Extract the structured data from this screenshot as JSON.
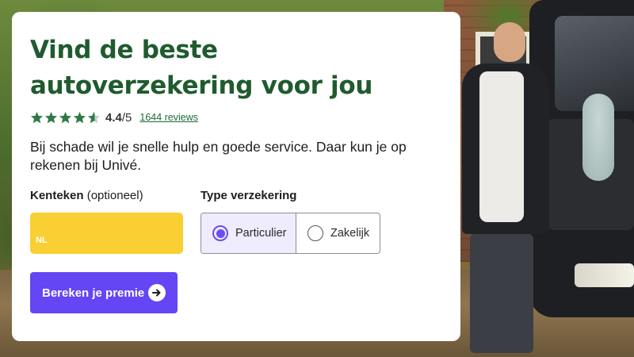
{
  "hero": {
    "title_line1": "Vind de beste",
    "title_line2": "autoverzekering voor jou",
    "rating": {
      "stars": 4.4,
      "max": 5,
      "score_text": "4.4",
      "max_text": "/5",
      "reviews_link": "1644 reviews"
    },
    "description": "Bij schade wil je snelle hulp en goede service. Daar kun je op rekenen bij Univé.",
    "kenteken": {
      "label": "Kenteken",
      "label_suffix": " (optioneel)",
      "country_code": "NL",
      "value": ""
    },
    "type": {
      "label": "Type verzekering",
      "options": [
        {
          "label": "Particulier",
          "selected": true
        },
        {
          "label": "Zakelijk",
          "selected": false
        }
      ]
    },
    "cta": {
      "label": "Bereken je premie"
    }
  },
  "icons": {
    "star": "star-icon",
    "star_half": "half-star-icon",
    "eu_flag": "eu-stars-icon",
    "arrow": "arrow-right-icon"
  },
  "colors": {
    "brand_green": "#1f5b2e",
    "star_green": "#2e7a44",
    "accent_purple": "#6446f4",
    "plate_yellow": "#f9cf33",
    "plate_blue": "#2a6fe0"
  }
}
